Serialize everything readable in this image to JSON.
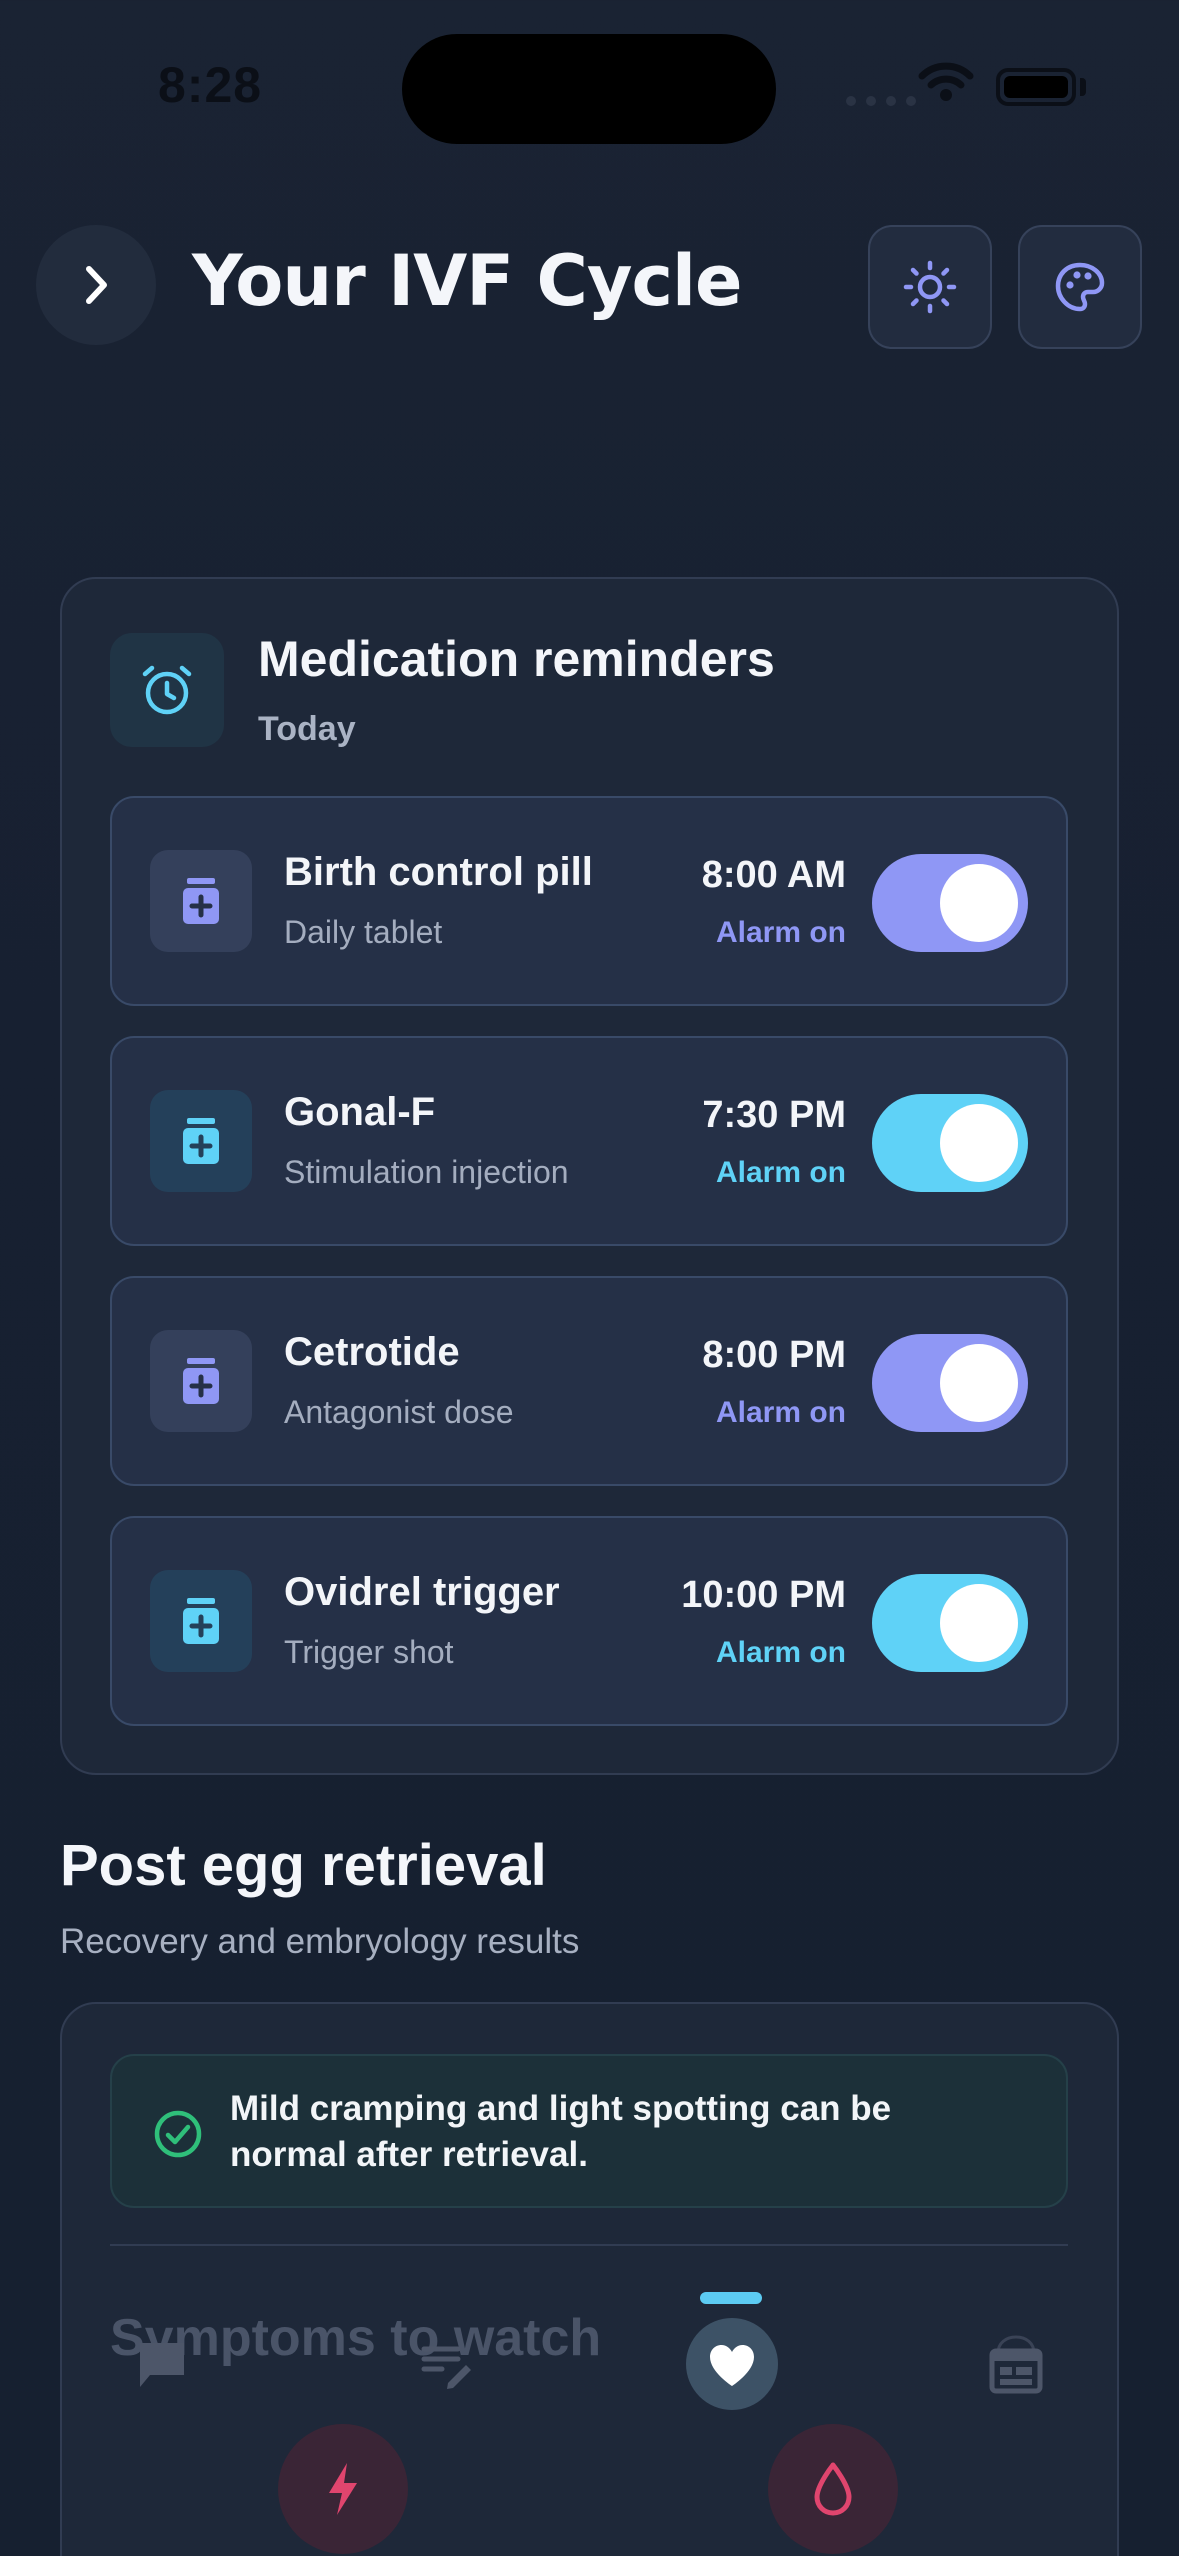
{
  "status_bar": {
    "time": "8:28"
  },
  "header": {
    "title": "Your IVF Cycle",
    "back_icon": "chevron-right-icon",
    "theme_icon": "sun-icon",
    "palette_icon": "palette-icon"
  },
  "reminders": {
    "title": "Medication reminders",
    "subtitle": "Today",
    "icon": "alarm-clock-icon",
    "items": [
      {
        "name": "Birth control pill",
        "desc": "Daily tablet",
        "time": "8:00 AM",
        "alarm": "Alarm on",
        "accent": "#8f97f5",
        "on": true
      },
      {
        "name": "Gonal-F",
        "desc": "Stimulation injection",
        "time": "7:30 PM",
        "alarm": "Alarm on",
        "accent": "#5fd2f7",
        "on": true
      },
      {
        "name": "Cetrotide",
        "desc": "Antagonist dose",
        "time": "8:00 PM",
        "alarm": "Alarm on",
        "accent": "#8f97f5",
        "on": true
      },
      {
        "name": "Ovidrel trigger",
        "desc": "Trigger shot",
        "time": "10:00 PM",
        "alarm": "Alarm on",
        "accent": "#5fd2f7",
        "on": true
      }
    ]
  },
  "post_retrieval": {
    "title": "Post egg retrieval",
    "subtitle": "Recovery and embryology results",
    "note": "Mild cramping and light spotting can be normal after retrieval.",
    "note_icon": "check-circle-icon",
    "symptoms_title": "Symptoms to watch",
    "symptom_icons": [
      "lightning-icon",
      "drop-icon"
    ]
  },
  "bottom_nav": {
    "tabs": [
      "chat-icon",
      "notes-icon",
      "heart-icon",
      "calendar-icon"
    ],
    "active": "heart-icon"
  },
  "colors": {
    "background": "#172031",
    "card": "#1e2839",
    "indigo_accent": "#8f97f5",
    "cyan_accent": "#5fd2f7",
    "success": "#2fbf7a",
    "danger": "#e0456e"
  }
}
